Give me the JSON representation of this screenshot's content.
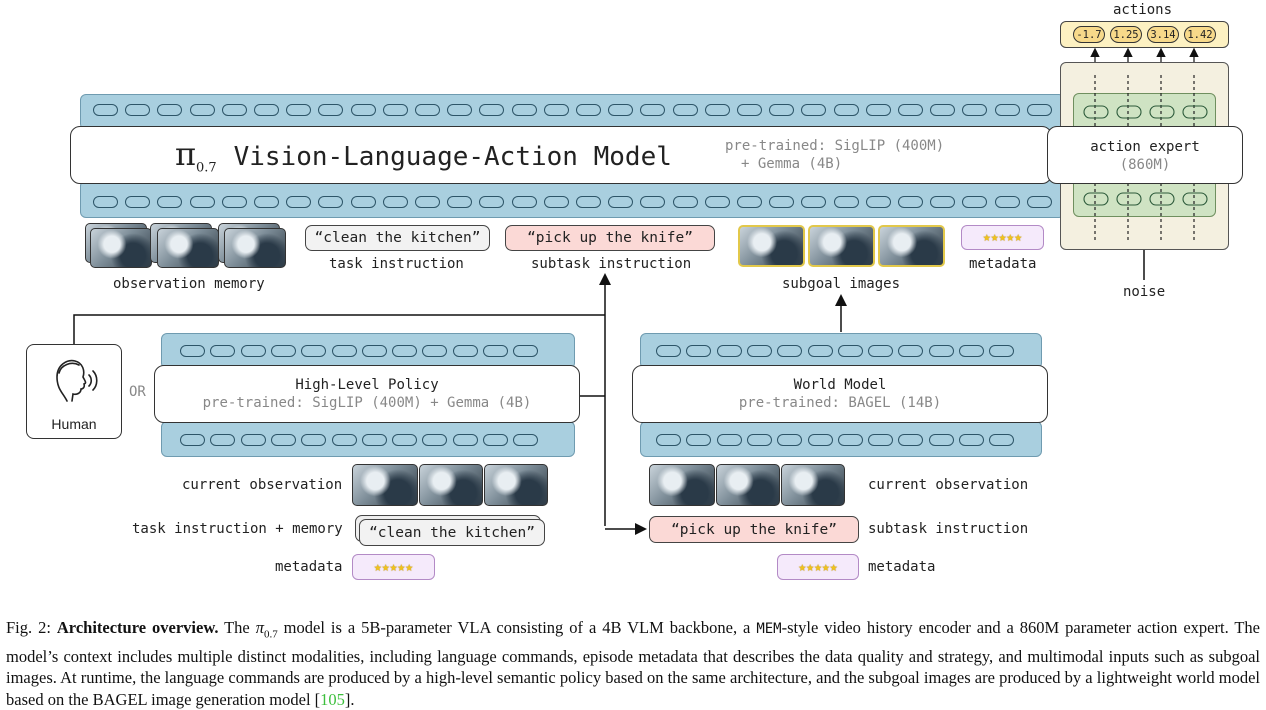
{
  "main_model": {
    "title_symbol": "π",
    "title_subscript": "0.7",
    "title_text": "Vision-Language-Action Model",
    "pretrained_line1": "pre-trained: SigLIP (400M)",
    "pretrained_line2": "+ Gemma (4B)"
  },
  "action_expert": {
    "title": "action expert",
    "params": "(860M)",
    "outputs_label": "actions",
    "action_values": [
      "-1.7",
      "1.25",
      "3.14",
      "1.42"
    ],
    "noise_label": "noise"
  },
  "inputs": {
    "observation_memory": "observation memory",
    "task_instruction_text": "“clean the kitchen”",
    "task_instruction_label": "task instruction",
    "subtask_instruction_text": "“pick up the knife”",
    "subtask_instruction_label": "subtask instruction",
    "subgoal_images_label": "subgoal images",
    "metadata_label": "metadata",
    "stars": "★★★★★"
  },
  "human": {
    "label": "Human",
    "or_text": "OR"
  },
  "high_level_policy": {
    "title": "High-Level Policy",
    "pretrained": "pre-trained: SigLIP (400M) + Gemma (4B)",
    "current_observation_label": "current observation",
    "task_memory_label": "task instruction + memory",
    "task_text": "“clean the kitchen”",
    "metadata_label": "metadata"
  },
  "world_model": {
    "title": "World Model",
    "pretrained": "pre-trained: BAGEL (14B)",
    "current_observation_label": "current observation",
    "subtask_text": "“pick up the knife”",
    "subtask_label": "subtask instruction",
    "metadata_label": "metadata"
  },
  "caption": {
    "fig_label": "Fig. 2: ",
    "bold_title": "Architecture overview.",
    "part1": " The ",
    "pi": "π",
    "pi_sub": "0.7",
    "part2": " model is a 5B-parameter VLA consisting of a 4B VLM backbone, a ",
    "mem": "MEM",
    "part3": "-style video history encoder and a 860M parameter action expert. The model’s context includes multiple distinct modalities, including language commands, episode metadata that describes the data quality and strategy, and multimodal inputs such as subgoal images. At runtime, the language commands are produced by a high-level semantic policy based on the same architecture, and the subgoal images are produced by a lightweight world model based on the BAGEL image generation model [",
    "ref": "105",
    "part4": "]."
  }
}
